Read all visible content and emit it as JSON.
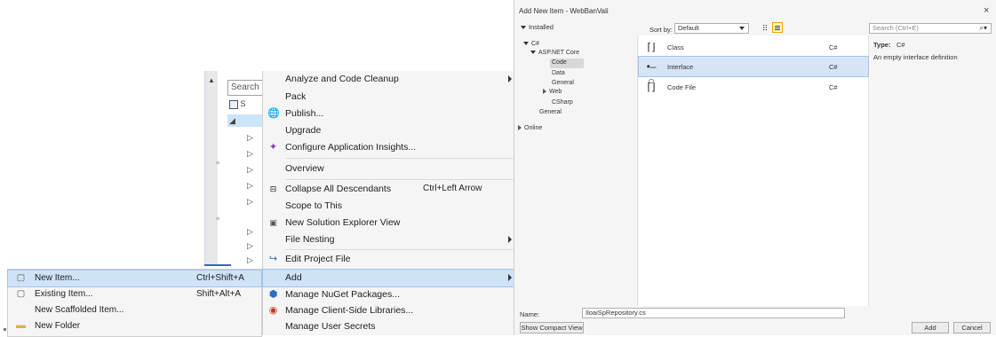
{
  "solution_explorer": {
    "search_text": "Search",
    "item_1_text": "S"
  },
  "context_menu": {
    "items": [
      {
        "label": "Analyze and Code Cleanup",
        "shortcut": "",
        "icon": "",
        "submenu": true
      },
      {
        "label": "Pack",
        "shortcut": "",
        "icon": "",
        "submenu": false
      },
      {
        "label": "Publish...",
        "shortcut": "",
        "icon": "globe-publish-icon",
        "submenu": false
      },
      {
        "label": "Upgrade",
        "shortcut": "",
        "icon": "",
        "submenu": false
      },
      {
        "label": "Configure Application Insights...",
        "shortcut": "",
        "icon": "app-insights-icon",
        "submenu": false
      },
      {
        "label": "Overview",
        "shortcut": "",
        "icon": "",
        "submenu": false
      },
      {
        "label": "Collapse All Descendants",
        "shortcut": "Ctrl+Left Arrow",
        "icon": "collapse-icon",
        "submenu": false
      },
      {
        "label": "Scope to This",
        "shortcut": "",
        "icon": "",
        "submenu": false
      },
      {
        "label": "New Solution Explorer View",
        "shortcut": "",
        "icon": "new-view-icon",
        "submenu": false
      },
      {
        "label": "File Nesting",
        "shortcut": "",
        "icon": "",
        "submenu": true
      },
      {
        "label": "Edit Project File",
        "shortcut": "",
        "icon": "edit-redo-icon",
        "submenu": false
      },
      {
        "label": "Add",
        "shortcut": "",
        "icon": "",
        "submenu": true
      },
      {
        "label": "Manage NuGet Packages...",
        "shortcut": "",
        "icon": "nuget-icon",
        "submenu": false
      },
      {
        "label": "Manage Client-Side Libraries...",
        "shortcut": "",
        "icon": "libraries-icon",
        "submenu": false
      },
      {
        "label": "Manage User Secrets",
        "shortcut": "",
        "icon": "",
        "submenu": false
      }
    ]
  },
  "add_submenu": {
    "items": [
      {
        "label": "New Item...",
        "shortcut": "Ctrl+Shift+A",
        "icon": "new-item-icon"
      },
      {
        "label": "Existing Item...",
        "shortcut": "Shift+Alt+A",
        "icon": "existing-item-icon"
      },
      {
        "label": "New Scaffolded Item...",
        "shortcut": "",
        "icon": ""
      },
      {
        "label": "New Folder",
        "shortcut": "",
        "icon": "folder-icon"
      }
    ]
  },
  "dialog": {
    "title": "Add New Item - WebBanVali",
    "close": "×",
    "tree_header": "Installed",
    "tree": {
      "csharp": "C#",
      "aspnet_core": "ASP.NET Core",
      "code": "Code",
      "data": "Data",
      "general_sub": "General",
      "web": "Web",
      "csharp_sub": "CSharp",
      "general": "General",
      "online": "Online"
    },
    "sort_label": "Sort by:",
    "sort_value": "Default",
    "search_placeholder": "Search (Ctrl+E)",
    "templates": [
      {
        "name": "Class",
        "lang": "C#",
        "icon": "class-icon"
      },
      {
        "name": "Interface",
        "lang": "C#",
        "icon": "interface-icon"
      },
      {
        "name": "Code File",
        "lang": "C#",
        "icon": "code-file-icon"
      }
    ],
    "description": {
      "type_label": "Type:",
      "type_value": "C#",
      "text": "An empty interface definition"
    },
    "name_label": "Name:",
    "name_value": "IloaiSpRepository.cs",
    "buttons": {
      "compact": "Show Compact View",
      "add": "Add",
      "cancel": "Cancel"
    }
  }
}
